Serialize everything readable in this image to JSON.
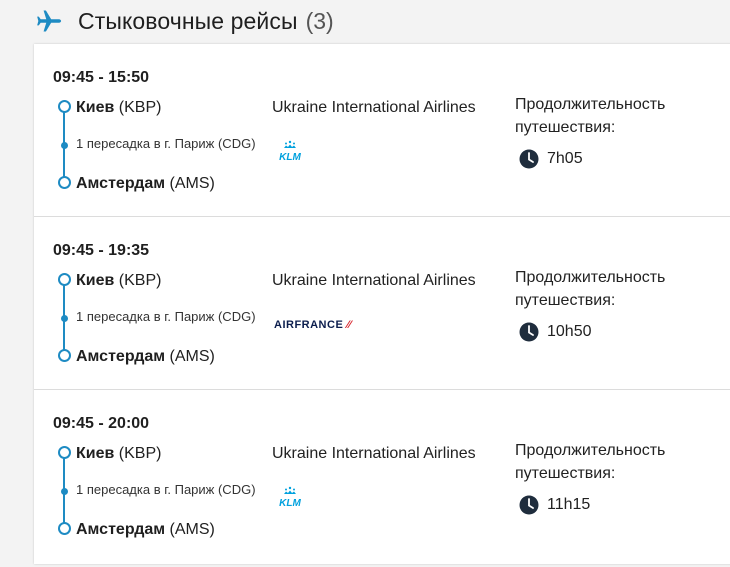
{
  "header": {
    "title": "Стыковочные рейсы",
    "count": "(3)"
  },
  "flights": [
    {
      "time": "09:45 - 15:50",
      "from_city": "Киев",
      "from_code": "(KBP)",
      "stop": "1 пересадка в г. Париж (CDG)",
      "to_city": "Амстердам",
      "to_code": "(AMS)",
      "airline": "Ukraine International Airlines",
      "partner_logo": "KLM",
      "duration_label": "Продолжительность путешествия:",
      "duration": "7h05"
    },
    {
      "time": "09:45 - 19:35",
      "from_city": "Киев",
      "from_code": "(KBP)",
      "stop": "1 пересадка в г. Париж (CDG)",
      "to_city": "Амстердам",
      "to_code": "(AMS)",
      "airline": "Ukraine International Airlines",
      "partner_logo": "AIRFRANCE",
      "duration_label": "Продолжительность путешествия:",
      "duration": "10h50"
    },
    {
      "time": "09:45 - 20:00",
      "from_city": "Киев",
      "from_code": "(KBP)",
      "stop": "1 пересадка в г. Париж (CDG)",
      "to_city": "Амстердам",
      "to_code": "(AMS)",
      "airline": "Ukraine International Airlines",
      "partner_logo": "KLM",
      "duration_label": "Продолжительность путешествия:",
      "duration": "11h15"
    }
  ],
  "colors": {
    "accent": "#1e8bc3",
    "klm_blue": "#00a1de",
    "airfrance_navy": "#0b1d4d",
    "airfrance_red": "#d8232a"
  },
  "icons": {
    "header": "plane-icon",
    "duration": "clock-icon"
  }
}
